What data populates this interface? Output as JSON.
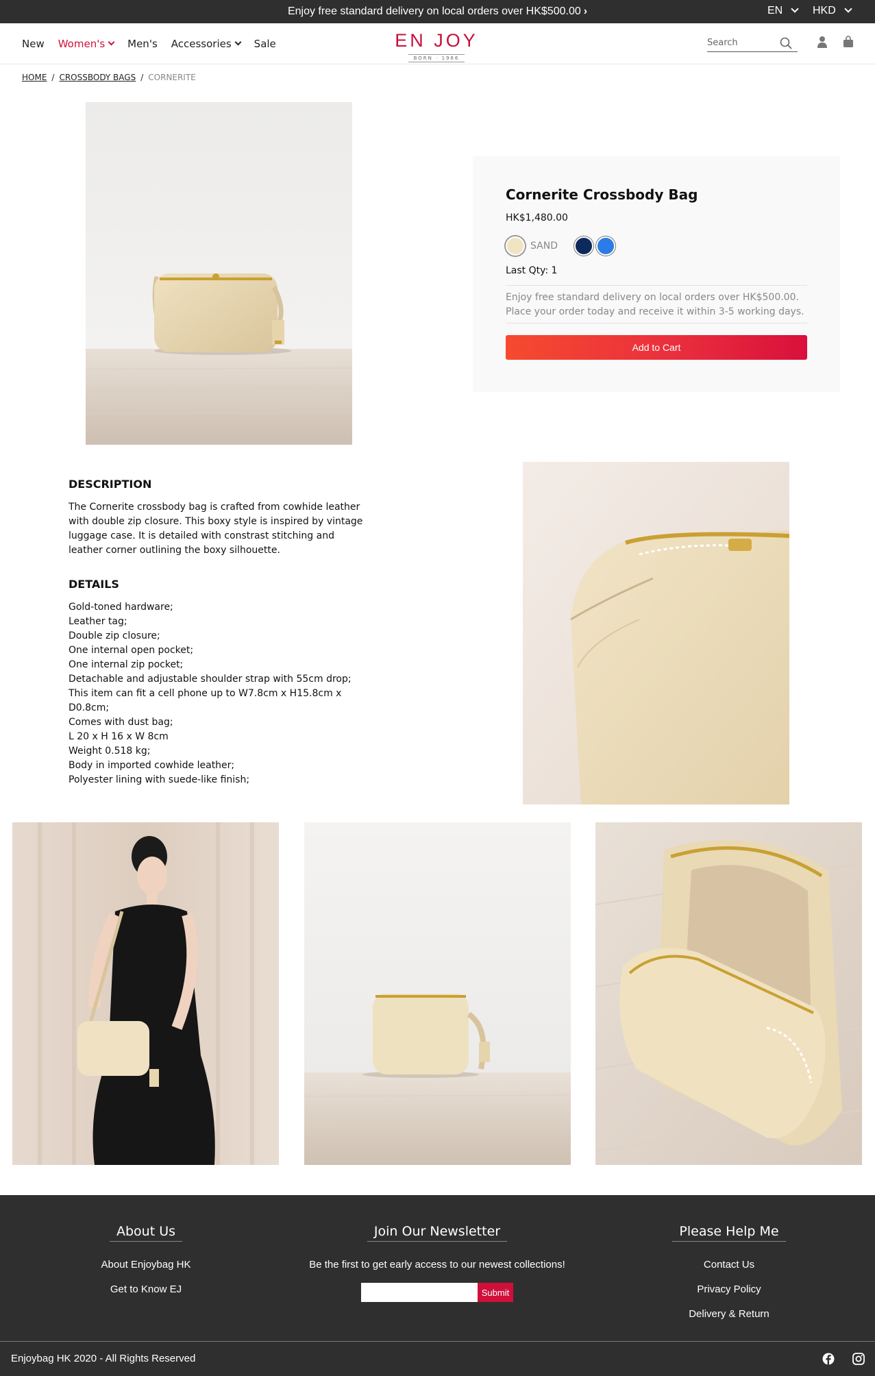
{
  "topbar": {
    "promo": "Enjoy free standard delivery on local orders over HK$500.00",
    "language": "EN",
    "currency": "HKD"
  },
  "nav": {
    "items": [
      "New",
      "Women's",
      "Men's",
      "Accessories",
      "Sale"
    ],
    "active": "Women's"
  },
  "logo": {
    "text": "EN JOY",
    "sub": "BORN · 1966"
  },
  "search": {
    "placeholder": "Search"
  },
  "breadcrumb": {
    "home": "HOME",
    "category": "CROSSBODY BAGS",
    "current": "CORNERITE"
  },
  "product": {
    "title": "Cornerite Crossbody Bag",
    "price": "HK$1,480.00",
    "selected_color": "SAND",
    "colors": [
      {
        "name": "SAND",
        "hex": "#f0e4c2"
      },
      {
        "name": "navy",
        "hex": "#0d2a5c"
      },
      {
        "name": "blue",
        "hex": "#2b7ce6"
      }
    ],
    "qty_label": "Last Qty: 1",
    "delivery_note": "Enjoy free standard delivery on local orders over HK$500.00. Place your order today and receive it within 3-5 working days.",
    "add_to_cart": "Add to Cart"
  },
  "description": {
    "heading": "DESCRIPTION",
    "body": "The Cornerite crossbody bag is crafted from cowhide leather with double zip closure. This boxy style is inspired by vintage luggage case. It is detailed with constrast stitching and leather corner outlining the boxy silhouette.",
    "details_heading": "DETAILS",
    "details": [
      "Gold-toned hardware;",
      "Leather tag;",
      "Double zip closure;",
      "One internal open pocket;",
      "One internal zip pocket;",
      "Detachable and adjustable shoulder strap with 55cm drop;",
      "This item can fit a cell phone up to W7.8cm x H15.8cm x D0.8cm;",
      "Comes with dust bag;",
      "L 20 x H 16 x W 8cm",
      "Weight 0.518 kg;",
      "Body in imported cowhide leather;",
      "Polyester lining with suede-like finish;"
    ]
  },
  "footer": {
    "about_heading": "About Us",
    "about_links": [
      "About Enjoybag HK",
      "Get to Know EJ"
    ],
    "newsletter_heading": "Join Our Newsletter",
    "newsletter_text": "Be the first to get early access to our newest collections!",
    "submit_label": "Submit",
    "help_heading": "Please Help Me",
    "help_links": [
      "Contact Us",
      "Privacy Policy",
      "Delivery & Return"
    ],
    "copyright": "Enjoybag HK 2020 - All Rights Reserved"
  },
  "colors": {
    "brand": "#c8103a",
    "accent_red": "#d0103a",
    "footer_bg": "#2f2f2f"
  },
  "icons": [
    "chevron-right-icon",
    "chevron-down-icon",
    "search-icon",
    "user-icon",
    "shopping-bag-icon",
    "facebook-icon",
    "instagram-icon"
  ]
}
